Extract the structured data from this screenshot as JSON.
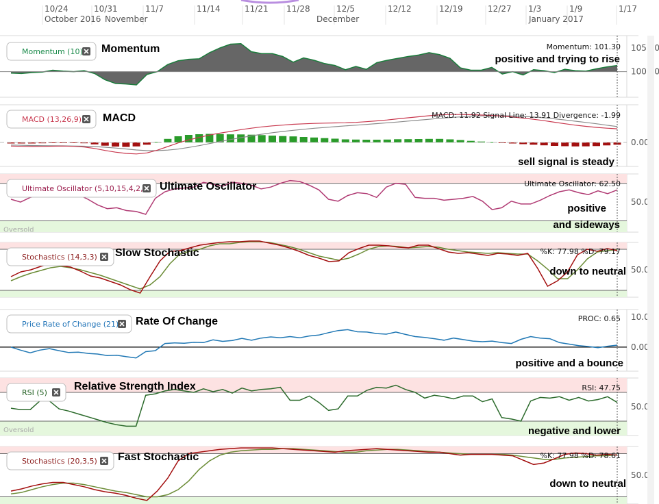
{
  "x_axis": {
    "date_ticks": [
      "10/24",
      "10/31",
      "11/7",
      "11/14",
      "11/21",
      "11/28",
      "12/5",
      "12/12",
      "12/19",
      "12/27",
      "1/3",
      "1/9",
      "1/17"
    ],
    "months": [
      "October 2016",
      "November",
      "December",
      "January 2017"
    ]
  },
  "chart_data": [
    {
      "type": "area",
      "indicator": "Momentum (10)",
      "heading": "Momentum",
      "readout": "Momentum: 101.30",
      "annotation": "positive and trying to rise",
      "y_ticks": [
        "105.00",
        "100.00"
      ],
      "baseline": 100,
      "ylim": [
        94.6,
        107.6
      ],
      "values": [
        99.7,
        99.6,
        99.8,
        99.9,
        100.3,
        100.1,
        100.0,
        100.2,
        99.6,
        98.3,
        97.5,
        97.4,
        97.2,
        99.4,
        100.0,
        101.5,
        102.3,
        102.6,
        102.7,
        104.0,
        105.0,
        105.8,
        105.9,
        104.2,
        103.8,
        103.8,
        103.2,
        102.0,
        102.9,
        102.4,
        101.7,
        101.3,
        100.4,
        101.1,
        100.5,
        101.9,
        102.4,
        102.8,
        103.2,
        103.5,
        104.0,
        103.6,
        102.8,
        100.8,
        100.3,
        100.3,
        100.9,
        99.5,
        100.0,
        99.3,
        100.4,
        100.2,
        99.8,
        100.5,
        100.2,
        100.1,
        100.6,
        101.0,
        101.3
      ]
    },
    {
      "type": "line",
      "indicator": "MACD (13,26,9)",
      "heading": "MACD",
      "readout": "MACD: 11.92 Signal Line: 13.91 Divergence: -1.99",
      "annotation": "sell signal is steady",
      "y_ticks": [
        "0.00"
      ],
      "ylim": [
        -21,
        33
      ],
      "series": [
        {
          "name": "MACD",
          "values": [
            -3.2,
            -3.4,
            -3.6,
            -3.5,
            -3.3,
            -3.2,
            -3.4,
            -4.0,
            -5.3,
            -7.0,
            -8.5,
            -9.6,
            -10.1,
            -9.2,
            -6.8,
            -3.6,
            -0.4,
            2.2,
            4.4,
            6.5,
            8.2,
            9.6,
            11.2,
            12.5,
            13.6,
            14.5,
            15.2,
            15.9,
            16.3,
            16.7,
            16.9,
            17.1,
            17.2,
            17.6,
            18.2,
            18.9,
            19.7,
            20.7,
            21.6,
            22.5,
            23.4,
            24.2,
            24.5,
            24.5,
            24.3,
            24.0,
            23.7,
            23.1,
            22.3,
            21.3,
            20.3,
            19.1,
            17.7,
            16.4,
            15.1,
            14.1,
            13.2,
            12.5,
            11.92
          ]
        },
        {
          "name": "Signal Line",
          "values": [
            -2.3,
            -2.5,
            -2.7,
            -2.8,
            -2.9,
            -3.0,
            -3.1,
            -3.3,
            -3.6,
            -4.2,
            -4.9,
            -5.7,
            -6.6,
            -7.2,
            -7.2,
            -6.7,
            -5.8,
            -4.4,
            -2.8,
            -1.0,
            0.8,
            2.5,
            4.2,
            5.7,
            7.2,
            8.5,
            9.6,
            10.6,
            11.5,
            12.4,
            13.1,
            13.8,
            14.5,
            15.1,
            15.8,
            16.5,
            17.2,
            17.9,
            18.7,
            19.5,
            20.3,
            21.1,
            21.8,
            22.4,
            22.9,
            23.2,
            23.4,
            23.4,
            23.2,
            22.8,
            22.3,
            21.6,
            20.7,
            19.7,
            18.6,
            17.5,
            16.4,
            15.1,
            13.91
          ]
        },
        {
          "name": "Divergence",
          "values": [
            -0.9,
            -0.9,
            -0.9,
            -0.7,
            -0.4,
            -0.2,
            -0.3,
            -0.7,
            -1.7,
            -2.8,
            -3.6,
            -3.9,
            -3.5,
            -2.0,
            0.4,
            3.1,
            5.4,
            6.6,
            7.2,
            7.5,
            7.4,
            7.1,
            7.0,
            6.8,
            6.4,
            6.0,
            5.6,
            5.3,
            4.8,
            4.3,
            3.8,
            3.3,
            2.7,
            2.5,
            2.4,
            2.4,
            2.5,
            2.8,
            2.9,
            3.0,
            3.1,
            3.1,
            2.7,
            2.1,
            1.4,
            0.8,
            0.3,
            -0.3,
            -0.9,
            -1.5,
            -2.0,
            -2.5,
            -3.0,
            -3.3,
            -3.5,
            -3.4,
            -3.2,
            -2.6,
            -1.99
          ]
        }
      ]
    },
    {
      "type": "line",
      "indicator": "Ultimate Oscillator (5,10,15,4,2,1)",
      "heading": "Ultimate Oscillator",
      "readout": "Ultimate Oscillator: 62.50",
      "annotation": [
        "positive",
        "and sideways"
      ],
      "y_ticks": [
        "50.00"
      ],
      "zones": {
        "overbought": 70,
        "oversold": 30,
        "oversold_label": "Oversold"
      },
      "ylim": [
        18,
        80
      ],
      "values": [
        53,
        50,
        55,
        57,
        61,
        62,
        61,
        58,
        53,
        47,
        43,
        44,
        41,
        40,
        37,
        54,
        61,
        64,
        65,
        66,
        71,
        69,
        67,
        71,
        70,
        68,
        64,
        66,
        70,
        73,
        72,
        68,
        63,
        53,
        51,
        57,
        60,
        59,
        55,
        66,
        70,
        69,
        55,
        54,
        54,
        52,
        53,
        54,
        56,
        51,
        42,
        44,
        51,
        48,
        48,
        52,
        57,
        61,
        63,
        60,
        58,
        62,
        59,
        63
      ]
    },
    {
      "type": "line",
      "indicator": "Stochastics (14,3,3)",
      "heading": "Slow Stochastic",
      "readout": "%K: 77.98 %D: 79.17",
      "annotation": "down to neutral",
      "y_ticks": [
        "50.00"
      ],
      "zones": {
        "overbought": 80,
        "oversold": 20
      },
      "ylim": [
        10,
        90
      ],
      "series": [
        {
          "name": "%K",
          "values": [
            40,
            47,
            50,
            55,
            59,
            56,
            54,
            48,
            41,
            38,
            33,
            28,
            21,
            16,
            40,
            63,
            77,
            78,
            82,
            86,
            88,
            90,
            91,
            91,
            92,
            92,
            89,
            86,
            82,
            77,
            71,
            67,
            62,
            63,
            75,
            81,
            86,
            86,
            85,
            83,
            82,
            86,
            86,
            81,
            76,
            74,
            75,
            73,
            71,
            74,
            73,
            71,
            74,
            52,
            26,
            34,
            47,
            72,
            80,
            77,
            81,
            78
          ]
        },
        {
          "name": "%D",
          "values": [
            34,
            40,
            45,
            49,
            53,
            55,
            53,
            50,
            46,
            42,
            37,
            32,
            27,
            22,
            28,
            40,
            59,
            73,
            77,
            80,
            85,
            88,
            88,
            90,
            91,
            91,
            90,
            87,
            84,
            80,
            75,
            70,
            67,
            64,
            67,
            73,
            80,
            84,
            85,
            84,
            82,
            83,
            84,
            83,
            80,
            78,
            76,
            75,
            74,
            75,
            74,
            73,
            73,
            63,
            51,
            37,
            37,
            50,
            66,
            76,
            78,
            79.17
          ]
        }
      ]
    },
    {
      "type": "line",
      "indicator": "Price Rate of Change (21)",
      "heading": "Rate Of Change",
      "readout": "PROC: 0.65",
      "annotation": "positive and a bounce",
      "y_ticks": [
        "10.00",
        "0.00"
      ],
      "baseline": 0,
      "ylim": [
        -8,
        12.5
      ],
      "values": [
        0.0,
        -1.0,
        -1.9,
        -1.0,
        -0.5,
        -1.2,
        -1.8,
        -1.7,
        -2.1,
        -2.3,
        -2.8,
        -2.7,
        -3.2,
        -3.6,
        -1.5,
        -1.2,
        1.2,
        1.4,
        1.3,
        1.6,
        1.5,
        2.4,
        1.9,
        2.2,
        2.9,
        2.3,
        3.0,
        3.4,
        3.1,
        3.5,
        3.1,
        3.7,
        4.0,
        4.8,
        5.5,
        5.8,
        5.1,
        5.0,
        4.5,
        4.3,
        5.0,
        4.2,
        3.5,
        3.2,
        2.8,
        2.3,
        3.0,
        2.5,
        2.0,
        1.8,
        2.0,
        1.5,
        1.2,
        2.6,
        3.5,
        3.0,
        2.8,
        1.5,
        1.0,
        0.5,
        0.2,
        -0.2,
        0.3,
        0.65
      ]
    },
    {
      "type": "line",
      "indicator": "RSI (5)",
      "heading": "Relative Strength Index",
      "readout": "RSI: 47.75",
      "annotation": "negative and lower",
      "y_ticks": [
        "50.00"
      ],
      "zones": {
        "overbought": 70,
        "oversold": 30,
        "oversold_label": "Oversold"
      },
      "ylim": [
        10,
        90
      ],
      "values": [
        48,
        46,
        46,
        58,
        58,
        47,
        44,
        40,
        36,
        32,
        28,
        25,
        23,
        23,
        66,
        68,
        72,
        74,
        72,
        70,
        75,
        71,
        74,
        69,
        76,
        72,
        74,
        75,
        77,
        59,
        59,
        65,
        56,
        45,
        47,
        65,
        65,
        73,
        77,
        76,
        80,
        74,
        70,
        62,
        66,
        64,
        61,
        65,
        65,
        57,
        61,
        35,
        33,
        30,
        58,
        63,
        62,
        64,
        59,
        63,
        58,
        60,
        64,
        56
      ]
    },
    {
      "type": "line",
      "indicator": "Stochastics (20,3,5)",
      "heading": "Fast Stochastic",
      "readout": "%K: 77.98 %D: 78.61",
      "annotation": "down to neutral",
      "y_ticks": [
        "50.00"
      ],
      "zones": {
        "overbought": 80,
        "oversold": 20
      },
      "ylim": [
        10,
        90
      ],
      "series": [
        {
          "name": "%K",
          "values": [
            28,
            31,
            35,
            38,
            40,
            40,
            37,
            34,
            30,
            27,
            25,
            22,
            18,
            15,
            28,
            46,
            70,
            80,
            82,
            84,
            86,
            87,
            88,
            88,
            88,
            88,
            87,
            86,
            85,
            84,
            83,
            82,
            84,
            85,
            86,
            87,
            86,
            85,
            84,
            83,
            82,
            82,
            80,
            78,
            79,
            79,
            79,
            78,
            77,
            71,
            65,
            67,
            73,
            79,
            81,
            80,
            78,
            79,
            78
          ]
        },
        {
          "name": "%D",
          "values": [
            24,
            26,
            30,
            34,
            37,
            39,
            39,
            37,
            34,
            31,
            28,
            26,
            23,
            20,
            20,
            23,
            30,
            42,
            58,
            70,
            78,
            82,
            84,
            85,
            86,
            86,
            87,
            87,
            86,
            85,
            84,
            83,
            82,
            82,
            84,
            85,
            86,
            86,
            85,
            84,
            83,
            82,
            81,
            80,
            79,
            79,
            79,
            79,
            78,
            76,
            74,
            72,
            72,
            74,
            75,
            76,
            77,
            77,
            78.61
          ]
        }
      ]
    }
  ],
  "colors": {
    "momentum_line": "#1b7d3c",
    "momentum_area": "#666666",
    "macd_line": "#c8374d",
    "signal_line": "#8a8a8a",
    "bar_positive": "#2a9b2a",
    "bar_negative": "#a31010",
    "ultimate_line": "#b03a73",
    "stoch_k": "#a30f0f",
    "stoch_d": "#6b8c36",
    "proc_line": "#1f77b4",
    "rsi_line": "#2b6a2b",
    "overbought_fill": "#fde2e2",
    "oversold_fill": "#e5f7dd",
    "pill_momentum": "#1a8a4a",
    "pill_macd": "#c8374d",
    "pill_ultimate": "#9a1c4c",
    "pill_stoch": "#8b1a1a",
    "pill_proc": "#1f73b7",
    "pill_rsi": "#1f5e1f"
  },
  "icons": {
    "pill_close": "close-icon"
  }
}
